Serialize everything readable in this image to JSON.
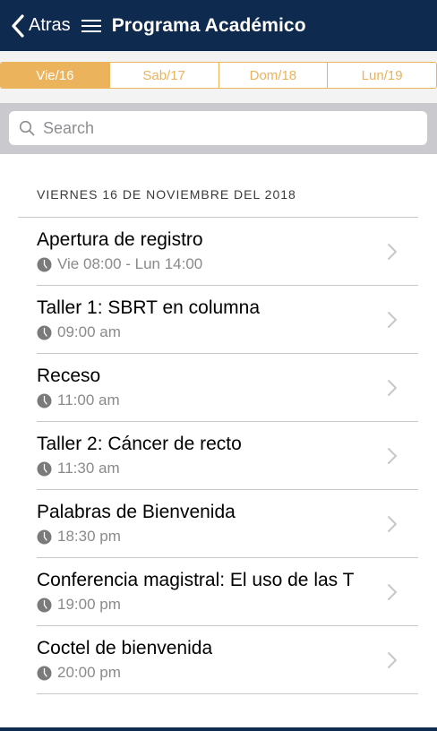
{
  "header": {
    "back_label": "Atras",
    "title": "Programa Académico",
    "icons": {
      "back": "chevron-left-icon",
      "menu": "hamburger-menu-icon"
    }
  },
  "tabs": [
    {
      "label": "Vie/16",
      "active": true
    },
    {
      "label": "Sab/17",
      "active": false
    },
    {
      "label": "Dom/18",
      "active": false
    },
    {
      "label": "Lun/19",
      "active": false
    }
  ],
  "search": {
    "placeholder": "Search",
    "value": ""
  },
  "section": {
    "header": "VIERNES 16 DE NOVIEMBRE DEL 2018"
  },
  "events": [
    {
      "title": "Apertura de registro",
      "time": "Vie 08:00 - Lun 14:00"
    },
    {
      "title": "Taller 1: SBRT en columna",
      "time": "09:00 am"
    },
    {
      "title": "Receso",
      "time": "11:00 am"
    },
    {
      "title": "Taller 2: Cáncer de recto",
      "time": "11:30 am"
    },
    {
      "title": "Palabras de Bienvenida",
      "time": "18:30 pm"
    },
    {
      "title": "Conferencia magistral: El uso de las T",
      "time": "19:00 pm"
    },
    {
      "title": "Coctel de bienvenida",
      "time": "20:00 pm"
    }
  ],
  "colors": {
    "navbar": "#0f2a4f",
    "accent": "#ebb35c",
    "search_bar": "#c9c9ce",
    "secondary_text": "#8a8a8a"
  }
}
